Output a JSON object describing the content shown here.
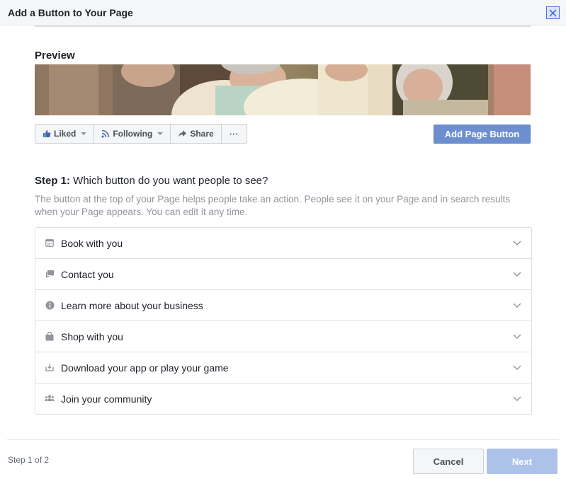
{
  "dialog": {
    "title": "Add a Button to Your Page"
  },
  "preview": {
    "heading": "Preview",
    "actions": [
      {
        "label": "Liked",
        "icon": "thumbs-up-icon"
      },
      {
        "label": "Following",
        "icon": "rss-icon"
      },
      {
        "label": "Share",
        "icon": "share-arrow-icon"
      },
      {
        "label": "···",
        "icon": "more-icon"
      }
    ],
    "add_button_label": "Add Page Button"
  },
  "step": {
    "prefix": "Step 1:",
    "question": " Which button do you want people to see?",
    "description": "The button at the top of your Page helps people take an action. People see it on your Page and in search results when your Page appears. You can edit it any time.",
    "options": [
      {
        "label": "Book with you",
        "icon": "calendar-icon"
      },
      {
        "label": "Contact you",
        "icon": "chat-bubbles-icon"
      },
      {
        "label": "Learn more about your business",
        "icon": "info-icon"
      },
      {
        "label": "Shop with you",
        "icon": "shopping-bag-icon"
      },
      {
        "label": "Download your app or play your game",
        "icon": "download-icon"
      },
      {
        "label": "Join your community",
        "icon": "people-icon"
      }
    ]
  },
  "footer": {
    "step_count": "Step 1 of 2",
    "cancel_label": "Cancel",
    "next_label": "Next"
  },
  "colors": {
    "accent": "#6e8fcf",
    "next_disabled": "#adc2e8",
    "muted_text": "#90949c"
  }
}
